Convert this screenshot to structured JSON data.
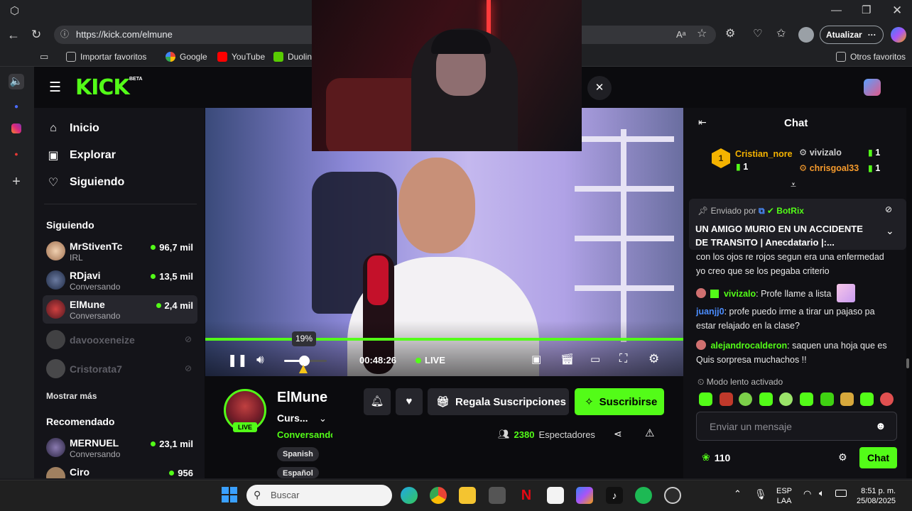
{
  "browser": {
    "url": "https://kick.com/elmune",
    "update_label": "Atualizar",
    "favorites": [
      "Importar favoritos",
      "Google",
      "YouTube",
      "Duolin"
    ],
    "other_favorites": "Otros favoritos"
  },
  "sidebar": {
    "nav": [
      {
        "label": "Inicio",
        "icon": "home-icon"
      },
      {
        "label": "Explorar",
        "icon": "explore-icon"
      },
      {
        "label": "Siguiendo",
        "icon": "heart-icon"
      }
    ],
    "following_header": "Siguiendo",
    "following": [
      {
        "name": "MrStivenTc",
        "sub": "IRL",
        "viewers": "96,7 mil"
      },
      {
        "name": "RDjavi",
        "sub": "Conversando",
        "viewers": "13,5 mil"
      },
      {
        "name": "ElMune",
        "sub": "Conversando",
        "viewers": "2,4 mil"
      },
      {
        "name": "davooxeneize",
        "sub": "",
        "viewers": ""
      },
      {
        "name": "Cristorata7",
        "sub": "",
        "viewers": ""
      }
    ],
    "show_more": "Mostrar más",
    "recommended_header": "Recomendado",
    "recommended": [
      {
        "name": "MERNUEL",
        "sub": "Conversando",
        "viewers": "23,1 mil"
      },
      {
        "name": "Ciro",
        "sub": "",
        "viewers": "956"
      }
    ]
  },
  "player": {
    "volume_label": "19%",
    "volume": 0.19,
    "time": "00:48:26",
    "live_label": "LIVE"
  },
  "channel": {
    "name": "ElMune",
    "category": "Curs...",
    "status": "Conversando",
    "live_badge": "LIVE",
    "tags": [
      "Spanish",
      "Español"
    ],
    "gift_label": "Regala Suscripciones",
    "subscribe_label": "Suscribirse",
    "viewers_count": "2380",
    "viewers_label": "Espectadores"
  },
  "chat": {
    "title": "Chat",
    "top_gifters": [
      {
        "name": "Cristian_nore",
        "count": "1",
        "rank": "1"
      },
      {
        "name": "vivizalo",
        "count": "1"
      },
      {
        "name": "chrisgoal33",
        "count": "1"
      }
    ],
    "pinned_by_label": "Enviado por",
    "pinned_by": "BotRix",
    "pinned_text": "UN AMIGO MURIO EN UN ACCIDENTE DE TRANSITO | Anecdatario |:...",
    "messages": [
      {
        "user": "",
        "text": "con los ojos re rojos segun era una enfermedad yo creo que se los pegaba criterio",
        "color": "#e8e8e8"
      },
      {
        "user": "vivizalo",
        "text": "Profe llame a lista",
        "color": "#53fc18"
      },
      {
        "user": "juanjj0",
        "text": "profe puedo irme a tirar un pajaso pa estar relajado en la clase?",
        "color": "#4b8dff"
      },
      {
        "user": "alejandrocalderon",
        "text": "saquen una hoja que es Quis sorpresa muchachos !!",
        "color": "#53fc18"
      }
    ],
    "slow_mode": "Modo lento activado",
    "input_placeholder": "Enviar un mensaje",
    "points": "110",
    "send_label": "Chat"
  },
  "taskbar": {
    "search_placeholder": "Buscar",
    "lang_top": "ESP",
    "lang_bottom": "LAA",
    "time": "8:51 p. m.",
    "date": "25/08/2025"
  },
  "colors": {
    "kick_green": "#53fc18",
    "background": "#0b0b0e",
    "panel": "#141419"
  }
}
